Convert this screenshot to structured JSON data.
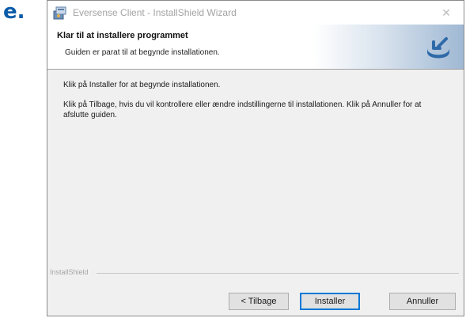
{
  "step_label": "e.",
  "window": {
    "title": "Eversense Client - InstallShield Wizard",
    "close_symbol": "✕",
    "icon": "installer-icon"
  },
  "banner": {
    "title": "Klar til at installere programmet",
    "subtitle": "Guiden er parat til at begynde installationen.",
    "icon": "install-arrow-icon"
  },
  "body": {
    "paragraph1": "Klik på Installer for at begynde installationen.",
    "paragraph2": "Klik på Tilbage, hvis du vil kontrollere eller ændre indstillingerne til installationen. Klik på Annuller for at afslutte guiden."
  },
  "footer": {
    "group_label": "InstallShield",
    "back_button": "< Tilbage",
    "install_button": "Installer",
    "cancel_button": "Annuller"
  },
  "colors": {
    "step_label": "#0a5ca8",
    "banner_accent": "#2f6aa8",
    "default_button_border": "#0078d7"
  }
}
